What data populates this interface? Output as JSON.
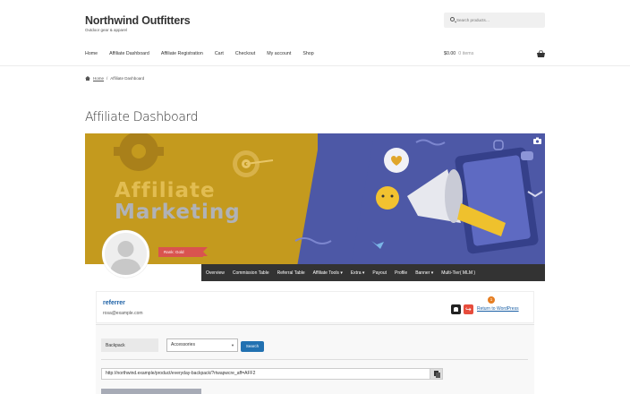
{
  "site": {
    "title": "Northwind Outfitters",
    "tagline": "Outdoor gear & apparel",
    "search_placeholder": "Search products…"
  },
  "nav": {
    "items": [
      "Home",
      "Affiliate Dashboard",
      "Affiliate Registration",
      "Cart",
      "Checkout",
      "My account",
      "Shop"
    ],
    "cart_total": "$0.00",
    "cart_items": "0 items"
  },
  "breadcrumb": {
    "home": "Home",
    "separator": "/",
    "current": "Affiliate Dashboard"
  },
  "page": {
    "title": "Affiliate Dashboard"
  },
  "banner": {
    "line1": "Affiliate",
    "line2": "Marketing",
    "rank": "Rank: Gold"
  },
  "tabs": [
    "Overview",
    "Commission Table",
    "Referral Table",
    "Affiliate Tools ▾",
    "Extra ▾",
    "Payout",
    "Profile",
    "Banner ▾",
    "Multi-Tier( MLM )"
  ],
  "user": {
    "name": "referrer",
    "email": "rosa@example.com",
    "notification_count": "1",
    "return_link": "Return to WordPress"
  },
  "tools": {
    "product_value": "Backpack",
    "category_value": "Accessories",
    "search_label": "Search",
    "affiliate_link": "http://northwind.example/product/everyday-backpack/?rtwapwcre_aff=AFF2"
  },
  "colors": {
    "banner_gold": "#c49a1e",
    "banner_blue": "#4d58a6",
    "rank_red": "#d9534f",
    "tab_bar": "#333333",
    "link_blue": "#1a5fa5",
    "button_blue": "#2271b1"
  }
}
